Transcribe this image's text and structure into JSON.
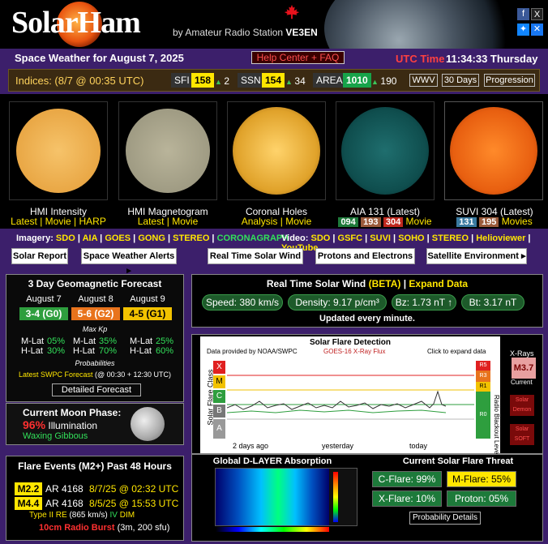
{
  "header": {
    "logo": "SolarHam",
    "byline_prefix": "by Amateur Radio Station",
    "callsign": "VE3EN"
  },
  "titlebar": {
    "title": "Space Weather for August 7, 2025",
    "help": "Help Center + FAQ",
    "utc_label": "UTC Time",
    "utc_time": "11:34:33 Thursday"
  },
  "indices": {
    "label": "Indices: (8/7 @ 00:35 UTC)",
    "sfi": {
      "label": "SFI",
      "value": "158",
      "delta": "2"
    },
    "ssn": {
      "label": "SSN",
      "value": "154",
      "delta": "34"
    },
    "area": {
      "label": "AREA",
      "value": "1010",
      "delta": "190"
    },
    "buttons": [
      "WWV",
      "30 Days",
      "Progression"
    ]
  },
  "images": [
    {
      "title": "HMI Intensity",
      "links": [
        "Latest",
        "Movie",
        "HARP"
      ]
    },
    {
      "title": "HMI Magnetogram",
      "links": [
        "Latest",
        "Movie"
      ]
    },
    {
      "title": "Coronal Holes",
      "links": [
        "Analysis",
        "Movie"
      ]
    },
    {
      "title": "AIA 131 (Latest)",
      "channels": [
        "094",
        "193",
        "304"
      ],
      "links": [
        "Movie"
      ]
    },
    {
      "title": "SUVI 304 (Latest)",
      "channels": [
        "131",
        "195"
      ],
      "links": [
        "Movies"
      ]
    }
  ],
  "imagery": {
    "label": "Imagery:",
    "items": [
      "SDO",
      "AIA",
      "GOES",
      "GONG",
      "STEREO",
      "CORONAGRAPH"
    ]
  },
  "video": {
    "label": "Video:",
    "items": [
      "SDO",
      "GSFC",
      "SUVI",
      "SOHO",
      "STEREO",
      "Helioviewer",
      "YouTube"
    ]
  },
  "nav": [
    "Solar Report",
    "Space Weather Alerts ▸",
    "Real Time Solar Wind",
    "Protons and Electrons",
    "Satellite Environment ▸"
  ],
  "forecast": {
    "title": "3 Day Geomagnetic Forecast",
    "days": [
      {
        "day": "August 7",
        "kp": "3-4 (G0)",
        "mlat": "05%",
        "hlat": "30%",
        "color": "#2e9e3e"
      },
      {
        "day": "August 8",
        "kp": "5-6 (G2)",
        "mlat": "35%",
        "hlat": "70%",
        "color": "#e8731c"
      },
      {
        "day": "August 9",
        "kp": "4-5 (G1)",
        "mlat": "25%",
        "hlat": "60%",
        "color": "#f2c200"
      }
    ],
    "max_kp": "Max Kp",
    "mlat_label": "M-Lat",
    "hlat_label": "H-Lat",
    "probabilities": "Probabilities",
    "swpc": "Latest SWPC Forecast",
    "swpc_times": "(@ 00:30 + 12:30 UTC)",
    "detailed": "Detailed Forecast"
  },
  "moon": {
    "title": "Current Moon Phase:",
    "pct": "96%",
    "illum": "Illumination",
    "phase": "Waxing Gibbous"
  },
  "flares": {
    "title": "Flare Events (M2+) Past 48 Hours",
    "events": [
      {
        "class": "M2.2",
        "ar": "AR 4168",
        "time": "8/7/25 @ 02:32 UTC"
      },
      {
        "class": "M4.4",
        "ar": "AR 4168",
        "time": "8/5/25 @ 15:53 UTC"
      }
    ],
    "type2": "Type II RE",
    "type2_speed": "(865 km/s)",
    "iv": "IV",
    "dim": "DIM",
    "radio": "10cm Radio Burst",
    "radio_detail": "(3m, 200 sfu)"
  },
  "solarwind": {
    "title": "Real Time Solar Wind",
    "beta": "(BETA)",
    "sep": "|",
    "expand": "Expand Data",
    "speed": "Speed: 380 km/s",
    "density": "Density: 9.17 p/cm³",
    "bz": "Bz: 1.73 nT ↑",
    "bt": "Bt: 3.17 nT",
    "updated": "Updated every minute."
  },
  "xray": {
    "title": "Solar Flare Detection",
    "provided": "Data provided by NOAA/SWPC",
    "goes": "GOES-16 X-Ray Flux",
    "click": "Click to expand data",
    "yaxis": "Solar Flare Class",
    "classes": [
      "X",
      "M",
      "C",
      "B",
      "A"
    ],
    "rlevels": [
      "R5",
      "R3",
      "R1",
      "R0"
    ],
    "ryaxis": "Radio Blackout Level",
    "ticks": [
      "2 days ago",
      "yesterday",
      "today"
    ],
    "side_label": "X-Rays",
    "current": "M3.7",
    "current_label": "Current",
    "demon_a": "Solar",
    "demon_b": "Demon",
    "soft_a": "Solar",
    "soft_b": "SOFT"
  },
  "dlayer": {
    "title": "Global D-LAYER Absorption"
  },
  "threat": {
    "title": "Current Solar Flare Threat",
    "cflare": "C-Flare: 99%",
    "mflare": "M-Flare: 55%",
    "xflare": "X-Flare: 10%",
    "proton": "Proton: 05%",
    "details": "Probability Details"
  }
}
